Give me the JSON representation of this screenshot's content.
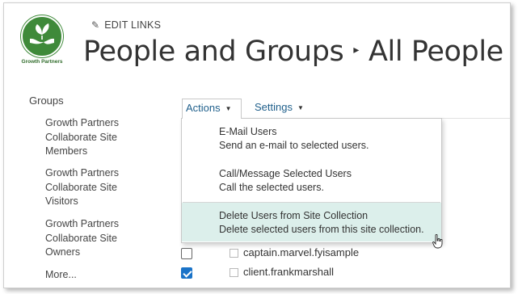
{
  "logo": {
    "caption": "Growth Partners",
    "icon": "hands-holding-plant-icon",
    "color": "#3f8a3a"
  },
  "header": {
    "edit_links": "EDIT LINKS",
    "breadcrumb_parent": "People and Groups",
    "breadcrumb_separator": "▸",
    "breadcrumb_current": "All People",
    "info_icon": "i"
  },
  "nav": {
    "title": "Groups",
    "items": [
      {
        "label": "Growth Partners Collaborate Site Members"
      },
      {
        "label": "Growth Partners Collaborate Site Visitors"
      },
      {
        "label": "Growth Partners Collaborate Site Owners"
      },
      {
        "label": "More..."
      }
    ]
  },
  "toolbar": {
    "actions_label": "Actions",
    "settings_label": "Settings",
    "link_color": "#1f5f8b"
  },
  "actions_menu": {
    "items": [
      {
        "title": "E-Mail Users",
        "description": "Send an e-mail to selected users."
      },
      {
        "title": "Call/Message Selected Users",
        "description": "Call the selected users."
      },
      {
        "title": "Delete Users from Site Collection",
        "description": "Delete selected users from this site collection.",
        "highlighted": true
      }
    ],
    "highlight_color": "#dcefeb"
  },
  "users": [
    {
      "name": "captain.marvel.fyisample",
      "checked": false
    },
    {
      "name": "client.frankmarshall",
      "checked": true
    }
  ],
  "checkbox_checked_color": "#1a73c8"
}
